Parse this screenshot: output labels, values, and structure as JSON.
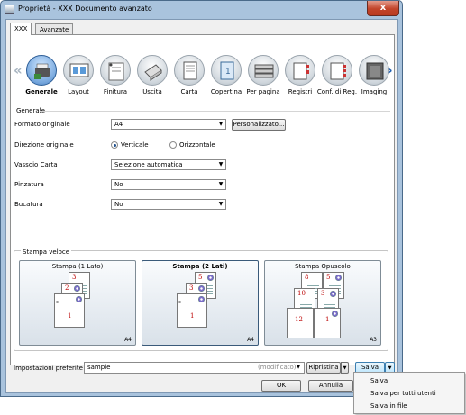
{
  "window": {
    "title": "Proprietà - XXX Documento avanzato",
    "close_label": "x"
  },
  "tabs": [
    {
      "label": "XXX",
      "active": true
    },
    {
      "label": "Avanzate",
      "active": false
    }
  ],
  "ribbon": {
    "left_arrow": "«",
    "right_arrow": "»",
    "items": [
      {
        "label": "Generale",
        "icon": "general-icon",
        "selected": true
      },
      {
        "label": "Layout",
        "icon": "layout-icon"
      },
      {
        "label": "Finitura",
        "icon": "finishing-icon"
      },
      {
        "label": "Uscita",
        "icon": "output-icon"
      },
      {
        "label": "Carta",
        "icon": "paper-icon"
      },
      {
        "label": "Copertina",
        "icon": "cover-icon"
      },
      {
        "label": "Per pagina",
        "icon": "per-page-icon"
      },
      {
        "label": "Registri",
        "icon": "tabs-icon"
      },
      {
        "label": "Conf. di Reg.",
        "icon": "tab-settings-icon"
      },
      {
        "label": "Imaging",
        "icon": "imaging-icon"
      }
    ]
  },
  "general": {
    "section_title": "Generale",
    "paper_size_label": "Formato originale",
    "paper_size_value": "A4",
    "custom_button": "Personalizzato...",
    "orientation_label": "Direzione originale",
    "portrait_label": "Verticale",
    "landscape_label": "Orizzontale",
    "orientation_selected": "Verticale",
    "tray_label": "Vassoio Carta",
    "tray_value": "Selezione automatica",
    "staple_label": "Pinzatura",
    "staple_value": "No",
    "punch_label": "Bucatura",
    "punch_value": "No"
  },
  "quick_print": {
    "group_title": "Stampa veloce",
    "cards": [
      {
        "title": "Stampa (1 Lato)",
        "paper": "A4",
        "pages": [
          "3",
          "2",
          "1"
        ]
      },
      {
        "title": "Stampa (2 Lati)",
        "paper": "A4",
        "pages": [
          "5",
          "3",
          "1"
        ]
      },
      {
        "title": "Stampa Opuscolo",
        "paper": "A3",
        "pages": [
          "8",
          "5",
          "10",
          "3",
          "12",
          "1"
        ]
      }
    ]
  },
  "preferences": {
    "label": "Impostazioni preferite",
    "value": "sample",
    "status": "(modificato)",
    "reset_button": "Ripristina",
    "save_button": "Salva"
  },
  "dialog_buttons": {
    "ok": "OK",
    "cancel": "Annulla"
  },
  "save_menu": {
    "items": [
      "Salva",
      "Salva per tutti utenti",
      "Salva in file"
    ]
  }
}
